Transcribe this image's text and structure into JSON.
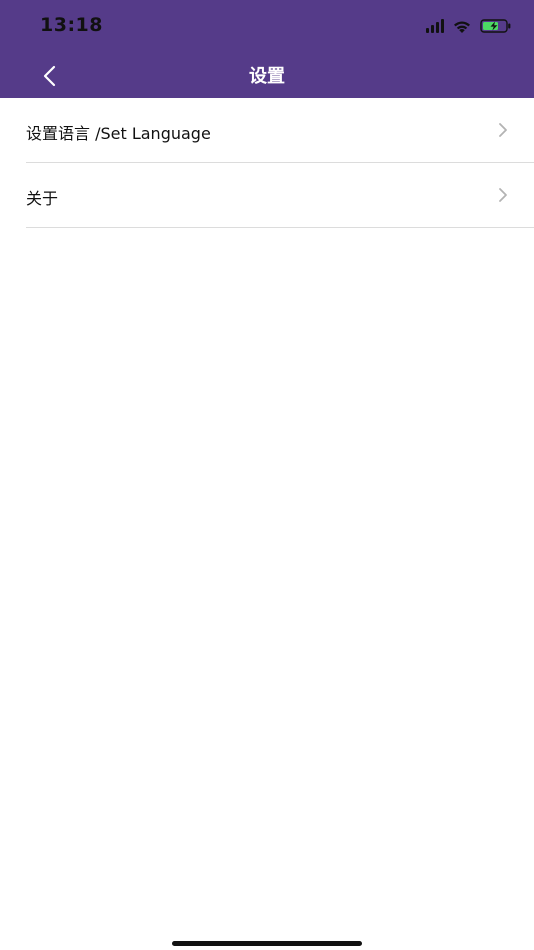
{
  "status_bar": {
    "time": "13:18",
    "signal_icon": "signal-icon",
    "wifi_icon": "wifi-icon",
    "battery_icon": "battery-charging-icon"
  },
  "header": {
    "title": "设置",
    "back_icon": "chevron-left-icon",
    "background_color": "#553b89"
  },
  "settings": {
    "items": [
      {
        "label": "设置语言 /Set Language",
        "icon": "chevron-right-icon"
      },
      {
        "label": "关于",
        "icon": "chevron-right-icon"
      }
    ]
  }
}
